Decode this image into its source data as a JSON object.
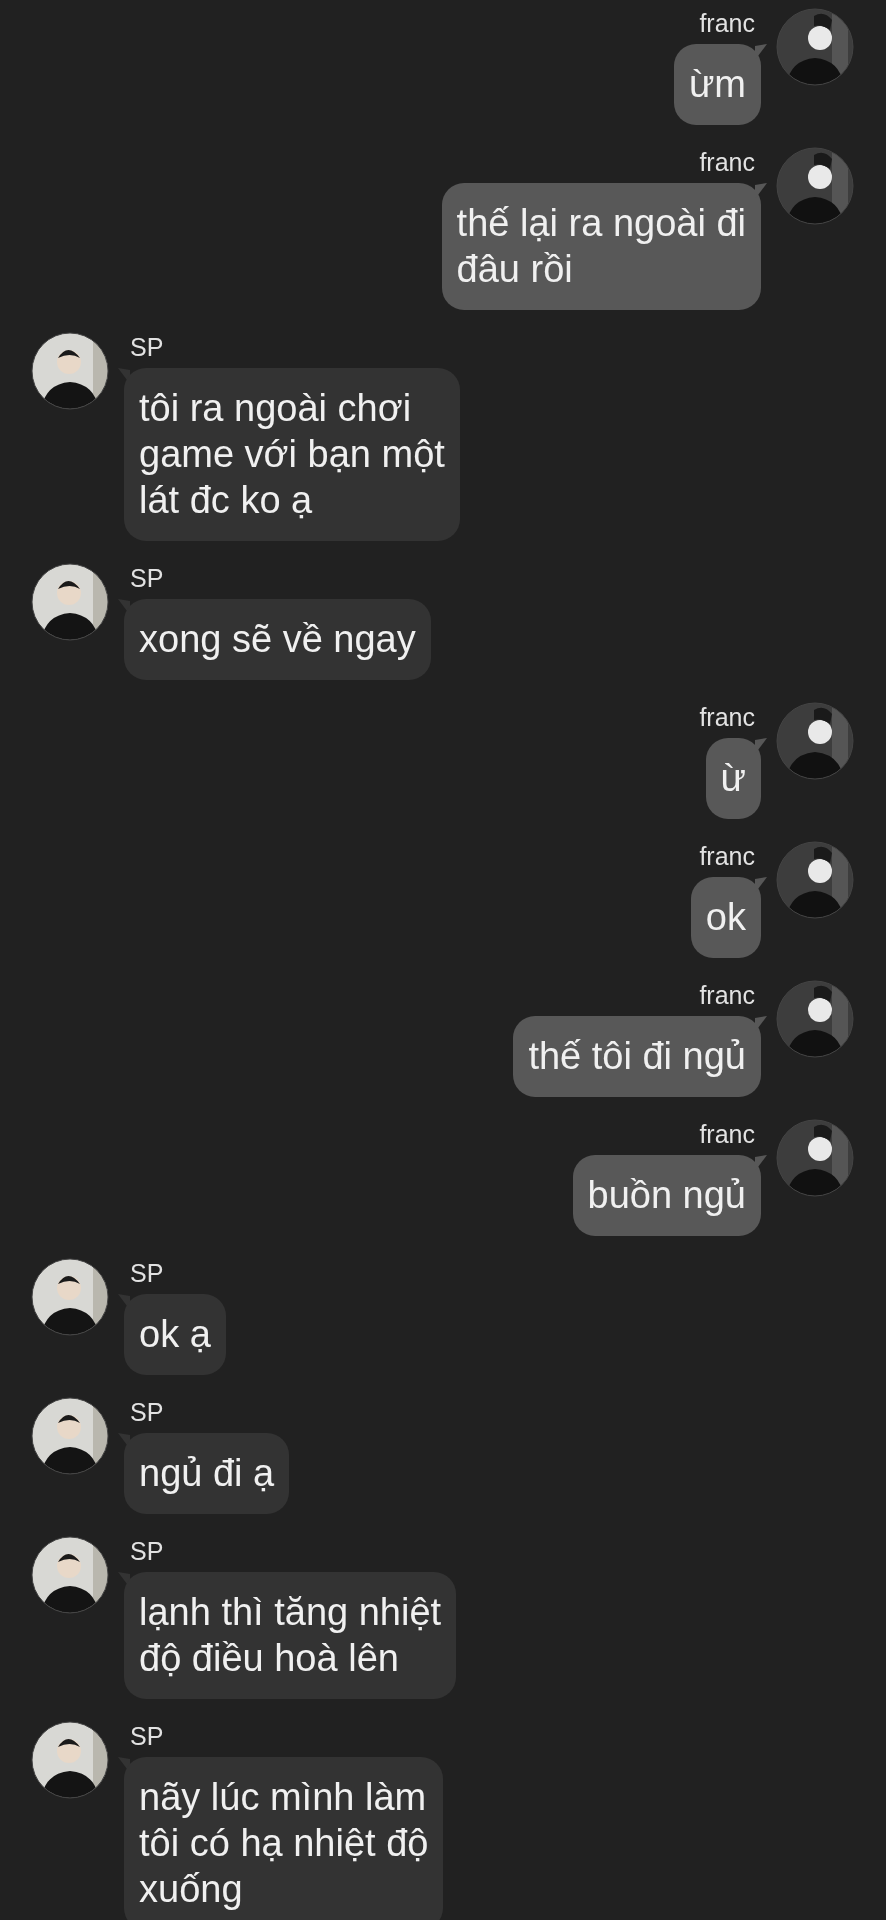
{
  "messages": [
    {
      "kind": "sent",
      "sender": "franc",
      "lines": [
        "ừm"
      ]
    },
    {
      "kind": "sent",
      "sender": "franc",
      "lines": [
        "thế lại ra ngoài đi",
        "đâu rồi"
      ]
    },
    {
      "kind": "received",
      "sender": "SP",
      "lines": [
        "tôi ra ngoài chơi",
        "game với bạn một",
        "lát đc ko ạ"
      ]
    },
    {
      "kind": "received",
      "sender": "SP",
      "lines": [
        "xong sẽ về ngay"
      ]
    },
    {
      "kind": "sent",
      "sender": "franc",
      "lines": [
        "ừ"
      ]
    },
    {
      "kind": "sent",
      "sender": "franc",
      "lines": [
        "ok"
      ]
    },
    {
      "kind": "sent",
      "sender": "franc",
      "lines": [
        "thế tôi đi ngủ"
      ]
    },
    {
      "kind": "sent",
      "sender": "franc",
      "lines": [
        "buồn ngủ"
      ]
    },
    {
      "kind": "received",
      "sender": "SP",
      "lines": [
        "ok ạ"
      ]
    },
    {
      "kind": "received",
      "sender": "SP",
      "lines": [
        "ngủ đi ạ"
      ]
    },
    {
      "kind": "received",
      "sender": "SP",
      "lines": [
        "lạnh thì tăng nhiệt",
        "độ điều hoà lên"
      ]
    },
    {
      "kind": "received",
      "sender": "SP",
      "lines": [
        "nãy lúc mình làm",
        "tôi có hạ nhiệt độ",
        "xuống"
      ]
    }
  ]
}
